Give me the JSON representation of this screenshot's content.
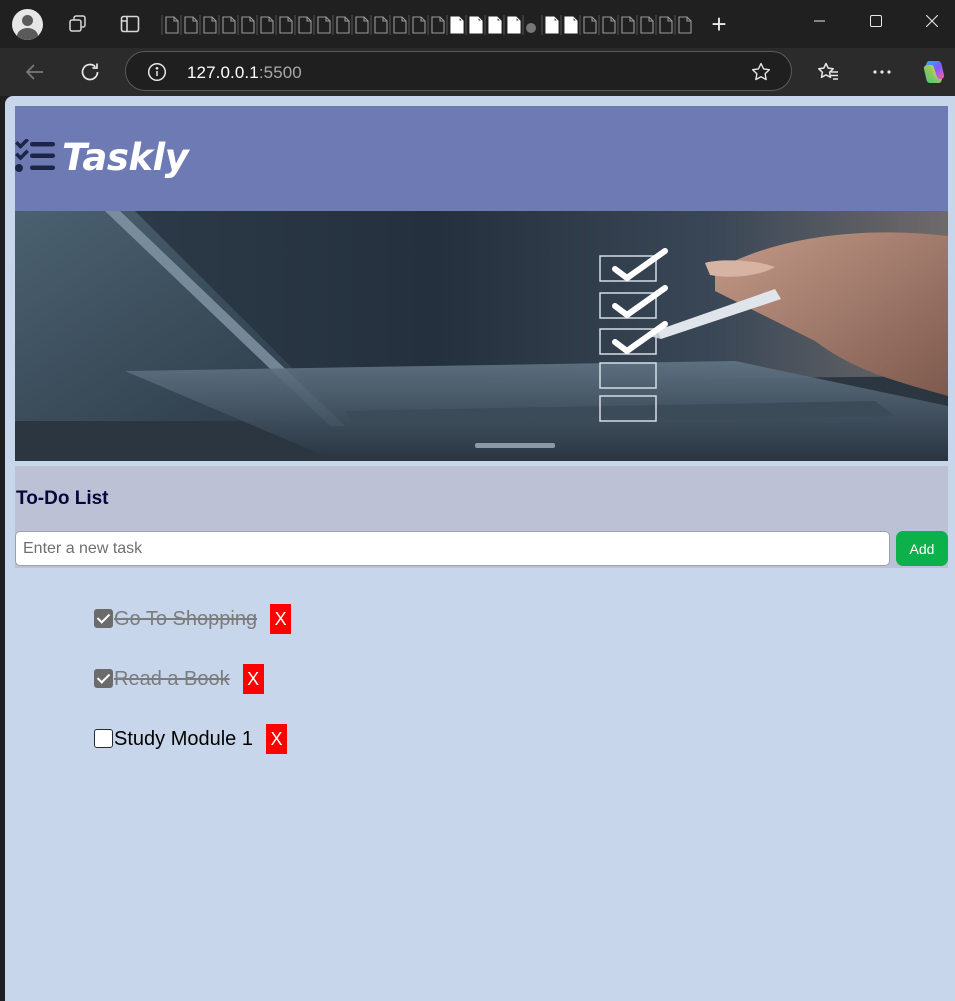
{
  "browser": {
    "url_host": "127.0.0.1",
    "url_port": ":5500",
    "new_tab_label": "+",
    "icons": [
      "profile-icon",
      "workspaces-icon",
      "tab-actions-icon",
      "minimize-icon",
      "maximize-icon",
      "close-icon",
      "back-icon",
      "refresh-icon",
      "site-info-icon",
      "favorite-star-icon",
      "favorites-icon",
      "more-icon",
      "copilot-icon"
    ]
  },
  "app": {
    "logo_text": "Taskly",
    "logo_icon": "checklist-icon",
    "brand_color": "#6d7ab3",
    "hero_image": "laptop-with-checklist"
  },
  "todo": {
    "title": "To-Do List",
    "input_placeholder": "Enter a new task",
    "input_value": "",
    "add_label": "Add",
    "delete_label": "X",
    "tasks": [
      {
        "text": "Go To Shopping",
        "done": true
      },
      {
        "text": "Read a Book",
        "done": true
      },
      {
        "text": "Study Module 1",
        "done": false
      }
    ]
  },
  "colors": {
    "add_button": "#0cb14b",
    "delete_button": "#ff0000",
    "page_background": "#c7d6ea",
    "panel_background": "#bdc1d5",
    "title_color": "#06063d"
  }
}
